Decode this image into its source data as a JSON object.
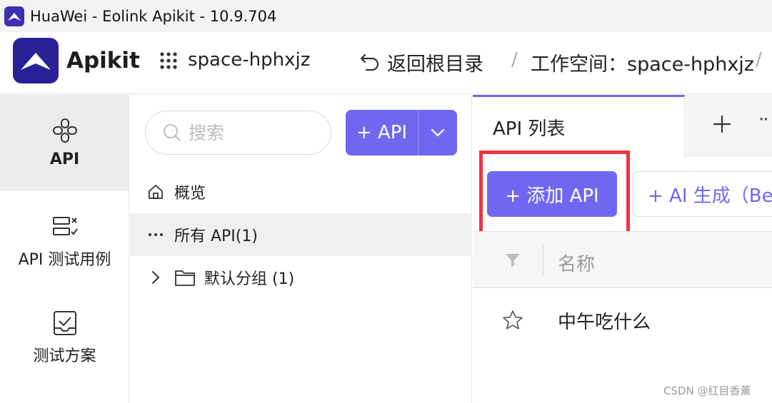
{
  "window": {
    "title": "HuaWei - Eolink Apikit - 10.9.704"
  },
  "header": {
    "logo_text": "Apikit",
    "space_name": "space-hphxjz",
    "back_label": "返回根目录",
    "breadcrumb_separator": "/",
    "workspace_label": "工作空间：space-hphxjz",
    "icons": {
      "grid": "grid-dots-icon",
      "back": "undo-arrow-icon"
    }
  },
  "leftnav": {
    "items": [
      {
        "label": "API",
        "icon": "api-icon",
        "active": true
      },
      {
        "label": "API 测试用例",
        "icon": "test-case-icon",
        "active": false
      },
      {
        "label": "测试方案",
        "icon": "test-plan-icon",
        "active": false
      }
    ]
  },
  "midpanel": {
    "search_placeholder": "搜索",
    "add_button_label": "+ API",
    "tree": [
      {
        "label": "概览",
        "icon": "home-icon"
      },
      {
        "label": "所有 API(1)",
        "icon": "more-dots-icon",
        "selected": true
      },
      {
        "label": "默认分组 (1)",
        "icon": "folder-icon"
      }
    ]
  },
  "rightpanel": {
    "active_tab": "API 列表",
    "tab_more": "··",
    "add_api_label": "+  添加 API",
    "ai_generate_label": "+  AI 生成（Be",
    "table": {
      "column_name": "名称",
      "rows": [
        {
          "name": "中午吃什么",
          "starred": false
        }
      ]
    }
  },
  "watermark": "CSDN @红目香薰",
  "colors": {
    "accent": "#7067f0",
    "brand": "#2a2196",
    "highlight": "#ef3340"
  }
}
